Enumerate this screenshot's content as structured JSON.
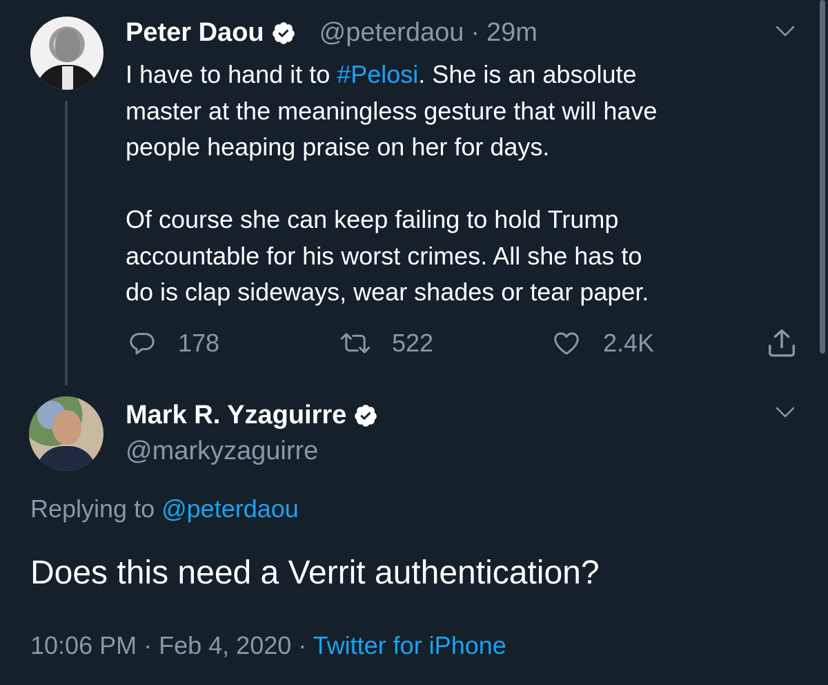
{
  "parent_tweet": {
    "author_name": "Peter Daou",
    "handle": "@peterdaou",
    "separator": "·",
    "time_ago": "29m",
    "verified": true,
    "text_lines": [
      "I have to hand it to ",
      "#Pelosi",
      ". She is an absolute",
      "master at the meaningless gesture that will have",
      "people heaping praise on her for days.",
      "Of course she can keep failing to hold Trump",
      "accountable for his worst crimes. All she has to",
      "do is clap sideways, wear shades or tear paper."
    ],
    "actions": {
      "replies": "178",
      "retweets": "522",
      "likes": "2.4K"
    }
  },
  "reply_tweet": {
    "author_name": "Mark R. Yzaguirre",
    "handle": "@markyzaguirre",
    "verified": true,
    "replying_prefix": "Replying to ",
    "replying_to": "@peterdaou",
    "text": "Does this need a Verrit authentication?",
    "time": "10:06 PM",
    "date": "Feb 4, 2020",
    "dot": "·",
    "source": "Twitter for iPhone"
  },
  "colors": {
    "background": "#15202b",
    "text": "#ffffff",
    "secondary": "#8899a6",
    "accent": "#1da1f2",
    "thread_line": "#38444d"
  },
  "icons": [
    "verified-badge-icon",
    "chevron-down-icon",
    "reply-icon",
    "retweet-icon",
    "like-icon",
    "share-icon"
  ]
}
